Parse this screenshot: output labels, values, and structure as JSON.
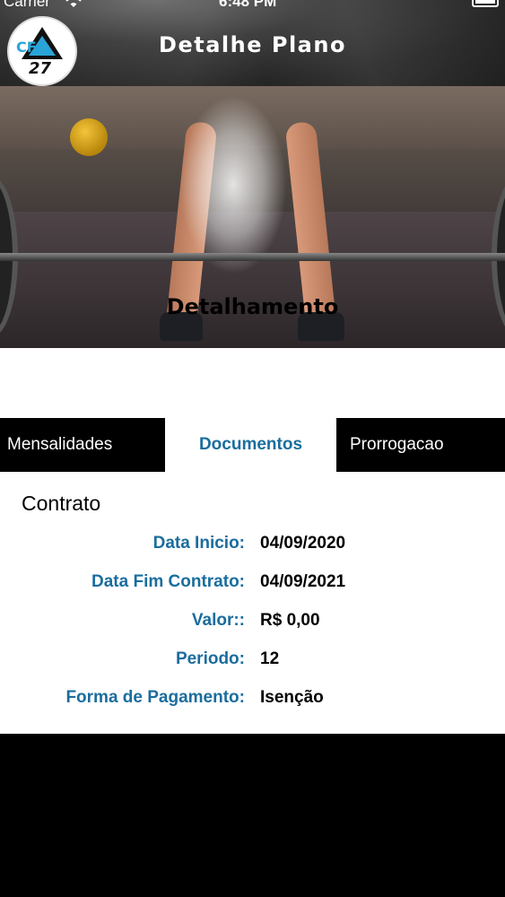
{
  "status_bar": {
    "carrier": "Carrier",
    "time": "6:48 PM"
  },
  "header": {
    "title": "Detalhe Plano",
    "logo_text": "CFA 27"
  },
  "hero": {
    "caption": "Detalhamento"
  },
  "tabs": [
    {
      "label": "Mensalidades",
      "selected": false
    },
    {
      "label": "Documentos",
      "selected": true
    },
    {
      "label": "Prorrogacao",
      "selected": false
    }
  ],
  "contract": {
    "title": "Contrato",
    "rows": [
      {
        "label": "Data Inicio:",
        "value": "04/09/2020"
      },
      {
        "label": "Data Fim Contrato:",
        "value": "04/09/2021"
      },
      {
        "label": "Valor::",
        "value": "R$ 0,00"
      },
      {
        "label": "Periodo:",
        "value": "12"
      },
      {
        "label": "Forma de Pagamento:",
        "value": "Isenção"
      }
    ]
  },
  "colors": {
    "accent": "#1a6d9e",
    "tab_bar": "#000000",
    "background": "#ffffff"
  }
}
